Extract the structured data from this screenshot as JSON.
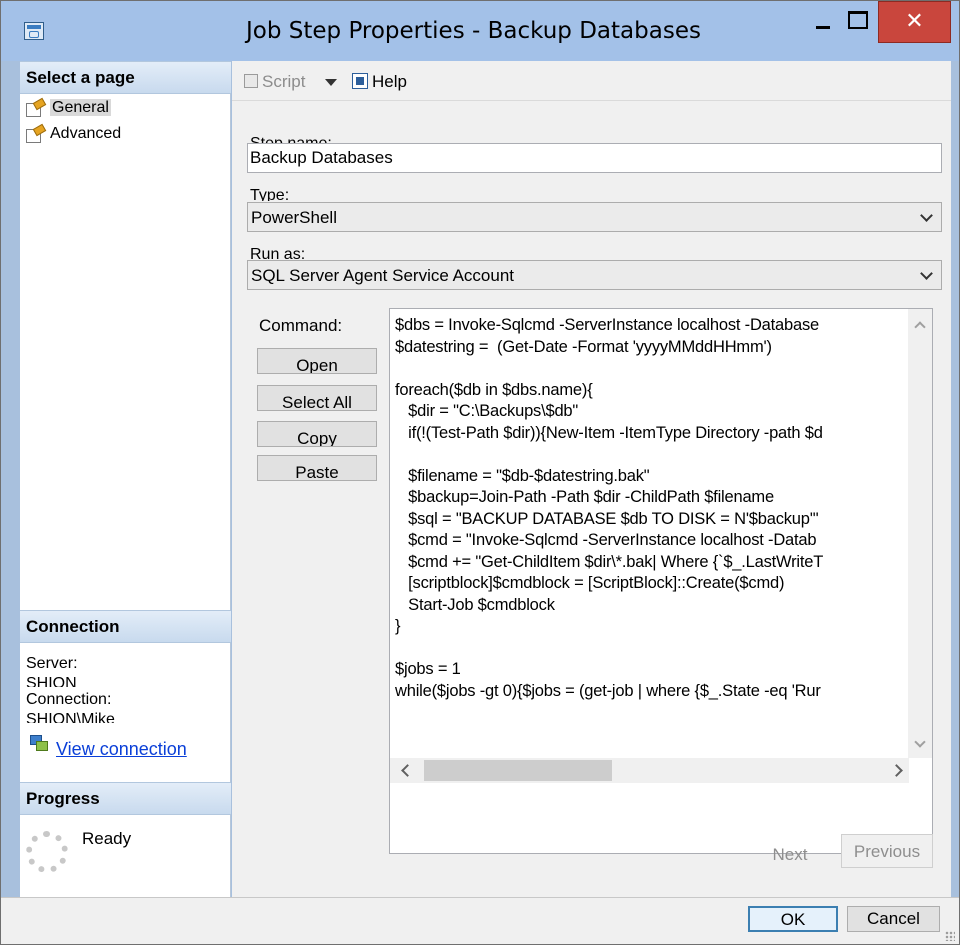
{
  "window": {
    "title": "Job Step Properties - Backup Databases",
    "close_glyph": "✕"
  },
  "left_pane": {
    "select_page_header": "Select a page",
    "pages": [
      {
        "label": "General",
        "selected": true
      },
      {
        "label": "Advanced",
        "selected": false
      }
    ],
    "connection_header": "Connection",
    "server_label": "Server:",
    "server_value": "SHION",
    "connection_label": "Connection:",
    "connection_value": "SHION\\Mike",
    "view_connection_link": "View connection",
    "progress_header": "Progress",
    "progress_status": "Ready"
  },
  "toolbar": {
    "script_label": "Script",
    "help_label": "Help"
  },
  "form": {
    "step_name_label": "Step name:",
    "step_name_value": "Backup Databases",
    "type_label": "Type:",
    "type_value": "PowerShell",
    "run_as_label": "Run as:",
    "run_as_value": "SQL Server Agent Service Account",
    "command_label": "Command:",
    "command_buttons": {
      "open": "Open",
      "select_all": "Select All",
      "copy": "Copy",
      "paste": "Paste"
    },
    "command_text": "$dbs = Invoke-Sqlcmd -ServerInstance localhost -Database\n$datestring =  (Get-Date -Format 'yyyyMMddHHmm')\n\nforeach($db in $dbs.name){\n   $dir = \"C:\\Backups\\$db\"\n   if(!(Test-Path $dir)){New-Item -ItemType Directory -path $d\n\n   $filename = \"$db-$datestring.bak\"\n   $backup=Join-Path -Path $dir -ChildPath $filename\n   $sql = \"BACKUP DATABASE $db TO DISK = N'$backup'\"\n   $cmd = \"Invoke-Sqlcmd -ServerInstance localhost -Datab\n   $cmd += \"Get-ChildItem $dir\\*.bak| Where {`$_.LastWriteT\n   [scriptblock]$cmdblock = [ScriptBlock]::Create($cmd)\n   Start-Job $cmdblock\n}\n\n$jobs = 1\nwhile($jobs -gt 0){$jobs = (get-job | where {$_.State -eq 'Rur",
    "next_label": "Next",
    "previous_label": "Previous"
  },
  "dialog_buttons": {
    "ok": "OK",
    "cancel": "Cancel"
  },
  "colors": {
    "title_bar": "#a3c1e8",
    "close_button": "#c9463d",
    "link": "#0a3fd8",
    "header_gradient_top": "#e3edf8",
    "header_gradient_bottom": "#c8daee"
  }
}
